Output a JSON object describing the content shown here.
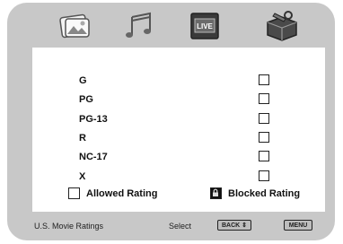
{
  "tabs": [
    {
      "icon": "picture-icon"
    },
    {
      "icon": "music-notes-icon"
    },
    {
      "icon": "live-tv-icon",
      "label": "LIVE"
    },
    {
      "icon": "settings-toolbox-icon",
      "active": true
    }
  ],
  "ratings": [
    {
      "label": "G"
    },
    {
      "label": "PG"
    },
    {
      "label": "PG-13"
    },
    {
      "label": "R"
    },
    {
      "label": "NC-17"
    },
    {
      "label": "X"
    }
  ],
  "legend": {
    "allowed_label": "Allowed Rating",
    "blocked_label": "Blocked Rating"
  },
  "footer": {
    "title": "U.S. Movie Ratings",
    "action": "Select",
    "key_back": "BACK ⇕",
    "key_menu": "MENU"
  }
}
